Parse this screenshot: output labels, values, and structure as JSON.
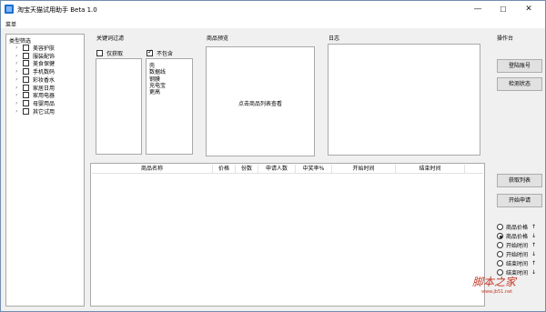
{
  "window": {
    "title": "淘宝天猫试用助手 Beta 1.0",
    "minimize_glyph": "—",
    "maximize_glyph": "☐",
    "close_glyph": "✕"
  },
  "menu": {
    "main": "菜单"
  },
  "category_filter": {
    "title": "类型筛选",
    "items": [
      {
        "label": "美容护肤",
        "checked": false
      },
      {
        "label": "服装配饰",
        "checked": false
      },
      {
        "label": "美食保健",
        "checked": false
      },
      {
        "label": "手机数码",
        "checked": false
      },
      {
        "label": "彩妆香水",
        "checked": false
      },
      {
        "label": "家居日用",
        "checked": false
      },
      {
        "label": "家用电器",
        "checked": false
      },
      {
        "label": "母婴用品",
        "checked": false
      },
      {
        "label": "其它试用",
        "checked": false
      }
    ]
  },
  "keyword_filter": {
    "title": "关键词过滤",
    "only_get": {
      "label": "仅获取",
      "checked": false
    },
    "exclude": {
      "label": "不包含",
      "checked": true
    },
    "exclude_words": [
      "壳",
      "数据线",
      "钢膜",
      "充电宝",
      "更高"
    ]
  },
  "preview": {
    "title": "商品预览",
    "hint": "点击商品列表查看"
  },
  "log": {
    "title": "日志"
  },
  "console": {
    "title": "操作台",
    "login_button": "登陆账号",
    "check_status_button": "检测状态",
    "fetch_list_button": "获取列表",
    "start_apply_button": "开始申请",
    "sort_options": [
      {
        "label": "商品价格",
        "arrow": "↑",
        "selected": false
      },
      {
        "label": "商品价格",
        "arrow": "↓",
        "selected": true
      },
      {
        "label": "开始时间",
        "arrow": "↑",
        "selected": false
      },
      {
        "label": "开始时间",
        "arrow": "↓",
        "selected": false
      },
      {
        "label": "结束时间",
        "arrow": "↑",
        "selected": false
      },
      {
        "label": "结束时间",
        "arrow": "↓",
        "selected": false
      }
    ]
  },
  "product_table": {
    "columns": [
      "商品名称",
      "价格",
      "份数",
      "申请人数",
      "中奖率%",
      "开始时间",
      "结束时间"
    ],
    "rows": []
  },
  "watermark": {
    "text": "脚本之家",
    "url": "www.jb51.net"
  },
  "colors": {
    "app_icon": "#1b6fd1",
    "border": "#a9a9a9",
    "button_bg": "#e1e1e1"
  }
}
